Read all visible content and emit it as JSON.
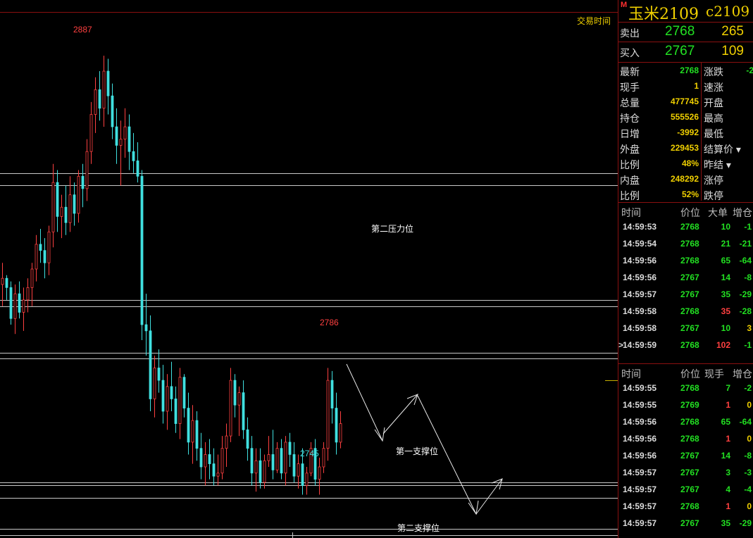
{
  "chart": {
    "price_range": [
      2731,
      2900
    ],
    "candles": [
      [
        2813,
        2820,
        2806,
        2815
      ],
      [
        2815,
        2816,
        2808,
        2812
      ],
      [
        2812,
        2814,
        2800,
        2802
      ],
      [
        2802,
        2813,
        2797,
        2810
      ],
      [
        2810,
        2814,
        2802,
        2804
      ],
      [
        2804,
        2812,
        2798,
        2808
      ],
      [
        2808,
        2815,
        2804,
        2812
      ],
      [
        2812,
        2820,
        2806,
        2818
      ],
      [
        2818,
        2829,
        2814,
        2826
      ],
      [
        2826,
        2831,
        2820,
        2824
      ],
      [
        2824,
        2828,
        2815,
        2820
      ],
      [
        2820,
        2832,
        2816,
        2830
      ],
      [
        2830,
        2852,
        2825,
        2846
      ],
      [
        2846,
        2850,
        2830,
        2835
      ],
      [
        2835,
        2842,
        2828,
        2838
      ],
      [
        2838,
        2845,
        2829,
        2833
      ],
      [
        2833,
        2848,
        2830,
        2842
      ],
      [
        2842,
        2846,
        2832,
        2836
      ],
      [
        2836,
        2850,
        2833,
        2848
      ],
      [
        2848,
        2852,
        2838,
        2844
      ],
      [
        2844,
        2860,
        2840,
        2856
      ],
      [
        2856,
        2872,
        2852,
        2868
      ],
      [
        2868,
        2880,
        2862,
        2876
      ],
      [
        2876,
        2882,
        2866,
        2870
      ],
      [
        2870,
        2887,
        2864,
        2882
      ],
      [
        2882,
        2886,
        2868,
        2874
      ],
      [
        2874,
        2878,
        2860,
        2864
      ],
      [
        2864,
        2870,
        2852,
        2858
      ],
      [
        2858,
        2866,
        2845,
        2860
      ],
      [
        2860,
        2870,
        2854,
        2864
      ],
      [
        2864,
        2868,
        2850,
        2856
      ],
      [
        2856,
        2862,
        2849,
        2853
      ],
      [
        2853,
        2859,
        2846,
        2848
      ],
      [
        2848,
        2850,
        2795,
        2800
      ],
      [
        2800,
        2810,
        2790,
        2798
      ],
      [
        2798,
        2803,
        2772,
        2776
      ],
      [
        2776,
        2790,
        2770,
        2786
      ],
      [
        2786,
        2792,
        2778,
        2782
      ],
      [
        2782,
        2787,
        2768,
        2772
      ],
      [
        2772,
        2784,
        2766,
        2780
      ],
      [
        2780,
        2788,
        2772,
        2776
      ],
      [
        2776,
        2780,
        2765,
        2768
      ],
      [
        2768,
        2786,
        2763,
        2783
      ],
      [
        2783,
        2784,
        2770,
        2773
      ],
      [
        2773,
        2778,
        2758,
        2762
      ],
      [
        2762,
        2774,
        2755,
        2769
      ],
      [
        2769,
        2772,
        2756,
        2760
      ],
      [
        2760,
        2765,
        2750,
        2754
      ],
      [
        2754,
        2762,
        2748,
        2758
      ],
      [
        2758,
        2763,
        2750,
        2755
      ],
      [
        2755,
        2760,
        2748,
        2751
      ],
      [
        2751,
        2758,
        2748,
        2752
      ],
      [
        2752,
        2764,
        2750,
        2760
      ],
      [
        2760,
        2768,
        2754,
        2764
      ],
      [
        2764,
        2786,
        2762,
        2782
      ],
      [
        2782,
        2784,
        2770,
        2774
      ],
      [
        2774,
        2780,
        2764,
        2778
      ],
      [
        2778,
        2782,
        2763,
        2766
      ],
      [
        2766,
        2770,
        2756,
        2760
      ],
      [
        2760,
        2764,
        2748,
        2752
      ],
      [
        2752,
        2760,
        2746,
        2756
      ],
      [
        2756,
        2760,
        2747,
        2749
      ],
      [
        2749,
        2758,
        2747,
        2756
      ],
      [
        2756,
        2764,
        2754,
        2758
      ],
      [
        2758,
        2766,
        2750,
        2753
      ],
      [
        2753,
        2762,
        2752,
        2760
      ],
      [
        2760,
        2763,
        2750,
        2752
      ],
      [
        2752,
        2764,
        2748,
        2762
      ],
      [
        2762,
        2765,
        2754,
        2758
      ],
      [
        2758,
        2762,
        2749,
        2751
      ],
      [
        2751,
        2758,
        2747,
        2755
      ],
      [
        2755,
        2760,
        2745,
        2748
      ],
      [
        2748,
        2754,
        2745,
        2752
      ],
      [
        2752,
        2762,
        2751,
        2760
      ],
      [
        2760,
        2763,
        2748,
        2750
      ],
      [
        2750,
        2757,
        2745,
        2754
      ],
      [
        2754,
        2762,
        2752,
        2760
      ],
      [
        2760,
        2786,
        2756,
        2782
      ],
      [
        2782,
        2785,
        2768,
        2773
      ],
      [
        2773,
        2778,
        2758,
        2762
      ],
      [
        2762,
        2772,
        2760,
        2768
      ]
    ],
    "hlines": [
      2849,
      2845,
      2808,
      2806,
      2791,
      2789,
      2749,
      2748,
      2744,
      2734,
      2732
    ],
    "annotations": {
      "high_label": "2887",
      "peak_label": "2786",
      "low_label": "2745",
      "resistance2": "第二压力位",
      "support1": "第一支撑位",
      "support2": "第二支撑位",
      "corner_tag": "交易时间"
    },
    "colors": {
      "up": "#ff4040",
      "down": "#40e0e0",
      "grid": "#c8c8c8",
      "border": "#8a1010"
    }
  },
  "header": {
    "m_badge": "M",
    "name": "玉米2109",
    "code": "c2109"
  },
  "quote": {
    "ask": {
      "label": "卖出",
      "price": "2768",
      "volume": "265"
    },
    "bid": {
      "label": "买入",
      "price": "2767",
      "volume": "109"
    }
  },
  "stats": [
    {
      "label": "最新",
      "value": "2768",
      "color": "#22e022",
      "label2": "涨跌",
      "value2": "-2"
    },
    {
      "label": "现手",
      "value": "1",
      "color": "#f0d000",
      "label2": "速涨",
      "value2": ""
    },
    {
      "label": "总量",
      "value": "477745",
      "color": "#f0d000",
      "label2": "开盘",
      "value2": ""
    },
    {
      "label": "持仓",
      "value": "555526",
      "color": "#f0d000",
      "label2": "最高",
      "value2": ""
    },
    {
      "label": "日增",
      "value": "-3992",
      "color": "#f0d000",
      "label2": "最低",
      "value2": ""
    },
    {
      "label": "外盘",
      "value": "229453",
      "color": "#f0d000",
      "label2": "结算价 ▾",
      "value2": ""
    },
    {
      "label": "比例",
      "value": "48%",
      "color": "#f0d000",
      "label2": "昨结 ▾",
      "value2": ""
    },
    {
      "label": "内盘",
      "value": "248292",
      "color": "#f0d000",
      "label2": "涨停",
      "value2": ""
    },
    {
      "label": "比例",
      "value": "52%",
      "color": "#f0d000",
      "label2": "跌停",
      "value2": ""
    }
  ],
  "big_orders": {
    "headers": [
      "时间",
      "价位",
      "大单",
      "增仓"
    ],
    "rows": [
      {
        "time": "14:59:53",
        "price": "2768",
        "vol": "10",
        "vol_color": "#22e022",
        "oi": "-1"
      },
      {
        "time": "14:59:54",
        "price": "2768",
        "vol": "21",
        "vol_color": "#22e022",
        "oi": "-21"
      },
      {
        "time": "14:59:56",
        "price": "2768",
        "vol": "65",
        "vol_color": "#22e022",
        "oi": "-64"
      },
      {
        "time": "14:59:56",
        "price": "2767",
        "vol": "14",
        "vol_color": "#22e022",
        "oi": "-8"
      },
      {
        "time": "14:59:57",
        "price": "2767",
        "vol": "35",
        "vol_color": "#22e022",
        "oi": "-29"
      },
      {
        "time": "14:59:58",
        "price": "2768",
        "vol": "35",
        "vol_color": "#ff4040",
        "oi": "-28"
      },
      {
        "time": "14:59:58",
        "price": "2767",
        "vol": "10",
        "vol_color": "#22e022",
        "oi": "3"
      },
      {
        "time": "14:59:59",
        "price": "2768",
        "vol": "102",
        "vol_color": "#ff4040",
        "oi": "-1"
      }
    ]
  },
  "ticks": {
    "headers": [
      "时间",
      "价位",
      "现手",
      "增仓"
    ],
    "rows": [
      {
        "time": "14:59:55",
        "price": "2768",
        "vol": "7",
        "vol_color": "#22e022",
        "oi": "-2"
      },
      {
        "time": "14:59:55",
        "price": "2769",
        "vol": "1",
        "vol_color": "#ff4040",
        "oi": "0"
      },
      {
        "time": "14:59:56",
        "price": "2768",
        "vol": "65",
        "vol_color": "#22e022",
        "oi": "-64"
      },
      {
        "time": "14:59:56",
        "price": "2768",
        "vol": "1",
        "vol_color": "#ff4040",
        "oi": "0"
      },
      {
        "time": "14:59:56",
        "price": "2767",
        "vol": "14",
        "vol_color": "#22e022",
        "oi": "-8"
      },
      {
        "time": "14:59:57",
        "price": "2767",
        "vol": "3",
        "vol_color": "#22e022",
        "oi": "-3"
      },
      {
        "time": "14:59:57",
        "price": "2767",
        "vol": "4",
        "vol_color": "#22e022",
        "oi": "-4"
      },
      {
        "time": "14:59:57",
        "price": "2768",
        "vol": "1",
        "vol_color": "#ff4040",
        "oi": "0"
      },
      {
        "time": "14:59:57",
        "price": "2767",
        "vol": "35",
        "vol_color": "#22e022",
        "oi": "-29"
      }
    ]
  }
}
